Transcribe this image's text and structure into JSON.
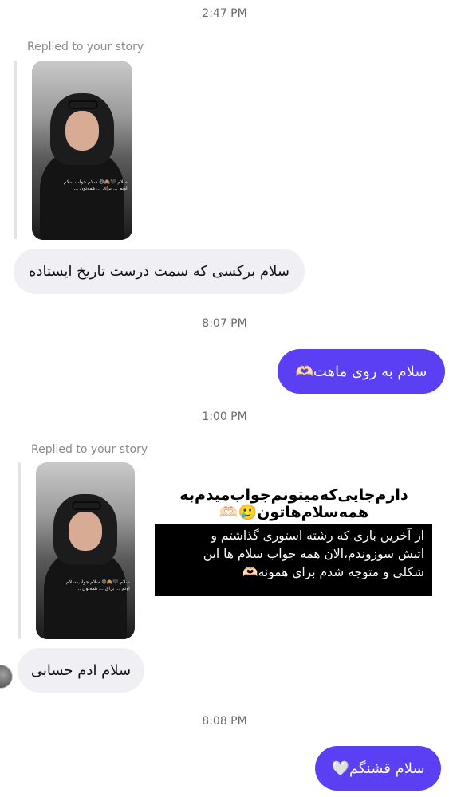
{
  "thread": {
    "timestamps": [
      "2:47 PM",
      "8:07 PM",
      "1:00 PM",
      "8:08 PM"
    ],
    "story_reply_label": "Replied to your story",
    "story_caption": "سلام 🖤🙈😍\nسلام جواب سلام اونم ... \nبرای ... همه‌تون ...",
    "messages": [
      {
        "from": "them",
        "text": "سلام برکسی که سمت درست تاریخ ایستاده"
      },
      {
        "from": "me",
        "text": "سلام به روی ماهت🫶🏻"
      },
      {
        "from": "them",
        "text": "سلام ادم حسابی"
      },
      {
        "from": "me",
        "text": "سلام قشنگم🤍"
      }
    ],
    "story_overlay": {
      "title_line1": "دارم‌جایی‌که‌میتونم‌جواب‌میدم‌به",
      "title_line2": "همه‌سلام‌هاتون🥲🫶🏻",
      "body_line1": "از آخرین باری که رشته استوری گذاشتم و",
      "body_line2": "اتیش سوزوندم،الان همه جواب سلام ها این",
      "body_line3": "شکلی و متوجه شدم برای همونه🫶🏻"
    }
  },
  "colors": {
    "outgoing_bubble": "#5b3ff2",
    "incoming_bubble": "#efeff4",
    "timestamp_text": "#6b6b6b"
  }
}
